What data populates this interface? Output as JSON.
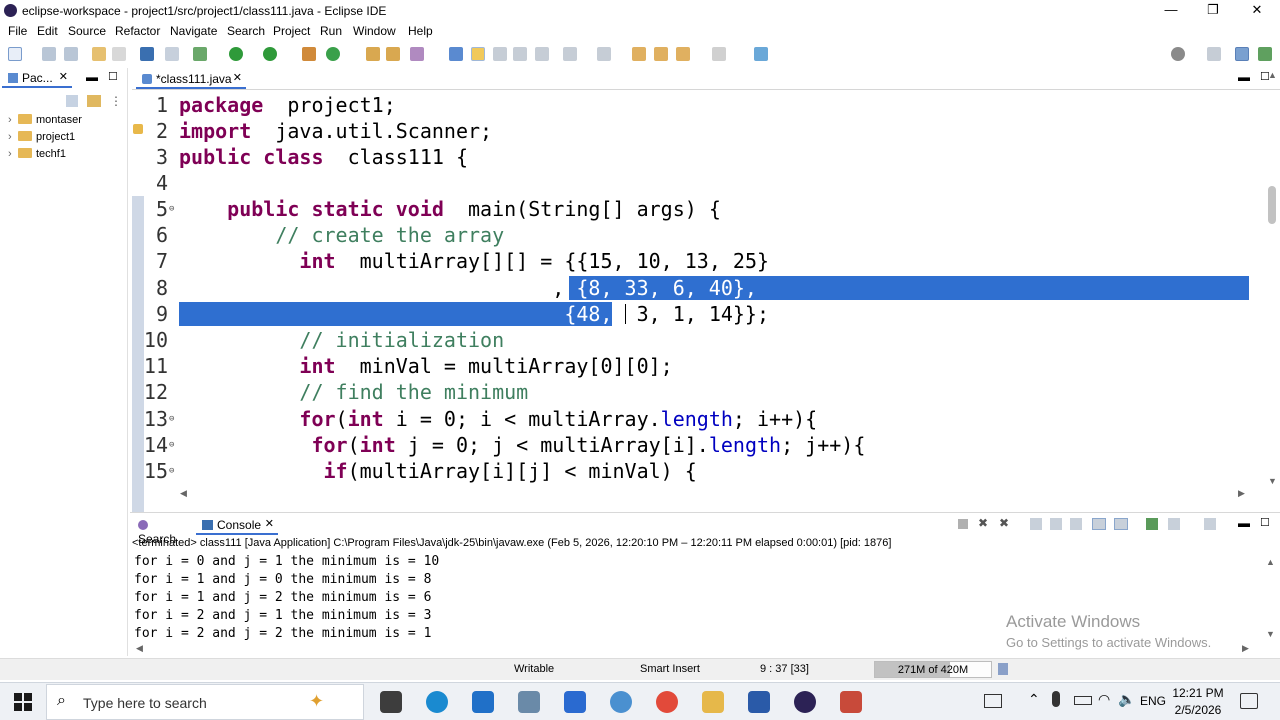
{
  "window": {
    "title": "eclipse-workspace - project1/src/project1/class111.java - Eclipse IDE",
    "controls": {
      "minimize": "—",
      "restore": "❐",
      "close": "✕"
    }
  },
  "menu": [
    "File",
    "Edit",
    "Source",
    "Refactor",
    "Navigate",
    "Search",
    "Project",
    "Run",
    "Window",
    "Help"
  ],
  "left_panel": {
    "tab_label": "Pac...",
    "tree": [
      {
        "label": "montaser"
      },
      {
        "label": "project1"
      },
      {
        "label": "techf1"
      }
    ]
  },
  "editor": {
    "tab_label": "*class111.java",
    "lines": [
      {
        "n": "1",
        "parts": [
          [
            "kw",
            "package"
          ],
          [
            "",
            "  project1;"
          ]
        ]
      },
      {
        "n": "2",
        "parts": [
          [
            "kw",
            "import"
          ],
          [
            "",
            "  java.util.Scanner;"
          ]
        ]
      },
      {
        "n": "3",
        "parts": [
          [
            "kw",
            "public"
          ],
          [
            "",
            " "
          ],
          [
            "kw",
            "class"
          ],
          [
            "",
            "  class111 {"
          ]
        ]
      },
      {
        "n": "4",
        "parts": []
      },
      {
        "n": "5",
        "fold": "⊖",
        "parts": [
          [
            "",
            "    "
          ],
          [
            "kw",
            "public"
          ],
          [
            "",
            " "
          ],
          [
            "kw",
            "static"
          ],
          [
            "",
            " "
          ],
          [
            "kw",
            "void"
          ],
          [
            "",
            "  main(String[] args) {"
          ]
        ]
      },
      {
        "n": "6",
        "parts": [
          [
            "",
            "        "
          ],
          [
            "cm",
            "// create the array"
          ]
        ]
      },
      {
        "n": "7",
        "parts": [
          [
            "",
            "          "
          ],
          [
            "kw",
            "int"
          ],
          [
            "",
            "  multiArray[][] = {{15, 10, 13, 25}"
          ]
        ]
      },
      {
        "n": "8",
        "parts": [
          [
            "",
            "                               , "
          ],
          [
            "sel",
            "{8, 33, 6, 40},"
          ]
        ]
      },
      {
        "n": "9",
        "parts": [
          [
            "sel",
            "                                {48,"
          ],
          [
            "",
            "  3, 1, 14}};"
          ]
        ]
      },
      {
        "n": "10",
        "parts": [
          [
            "",
            "          "
          ],
          [
            "cm",
            "// initialization"
          ]
        ]
      },
      {
        "n": "11",
        "parts": [
          [
            "",
            "          "
          ],
          [
            "kw",
            "int"
          ],
          [
            "",
            "  minVal = multiArray[0][0];"
          ]
        ]
      },
      {
        "n": "12",
        "parts": [
          [
            "",
            "          "
          ],
          [
            "cm",
            "// find the minimum"
          ]
        ]
      },
      {
        "n": "13",
        "fold": "⊖",
        "parts": [
          [
            "",
            "          "
          ],
          [
            "kw",
            "for"
          ],
          [
            "",
            "("
          ],
          [
            "kw",
            "int"
          ],
          [
            "",
            " i = 0; i < multiArray."
          ],
          [
            "fld",
            "length"
          ],
          [
            "",
            "; i++){"
          ]
        ]
      },
      {
        "n": "14",
        "fold": "⊖",
        "parts": [
          [
            "",
            "           "
          ],
          [
            "kw",
            "for"
          ],
          [
            "",
            "("
          ],
          [
            "kw",
            "int"
          ],
          [
            "",
            " j = 0; j < multiArray[i]."
          ],
          [
            "fld",
            "length"
          ],
          [
            "",
            "; j++){"
          ]
        ]
      },
      {
        "n": "15",
        "fold": "⊖",
        "parts": [
          [
            "",
            "            "
          ],
          [
            "kw",
            "if"
          ],
          [
            "",
            "(multiArray[i][j] < minVal) {"
          ]
        ]
      }
    ]
  },
  "console": {
    "tabs": [
      {
        "label": "Search"
      },
      {
        "label": "Console"
      }
    ],
    "header": "<terminated> class111 [Java Application] C:\\Program Files\\Java\\jdk-25\\bin\\javaw.exe  (Feb 5, 2026, 12:20:10 PM – 12:20:11 PM elapsed 0:00:01) [pid: 1876]",
    "lines": [
      "for i = 0 and j = 1 the minimum is = 10",
      "for i = 1 and j = 0 the minimum is = 8",
      "for i = 1 and j = 2 the minimum is = 6",
      "for i = 2 and j = 1 the minimum is = 3",
      "for i = 2 and j = 2 the minimum is = 1"
    ]
  },
  "watermark": {
    "title": "Activate Windows",
    "subtitle": "Go to Settings to activate Windows."
  },
  "status": {
    "writable": "Writable",
    "insert_mode": "Smart Insert",
    "position": "9 : 37 [33]",
    "heap": "271M of 420M",
    "heap_fraction": 0.645
  },
  "taskbar": {
    "search_placeholder": "Type here to search",
    "language": "ENG",
    "time": "12:21 PM",
    "date": "2/5/2026"
  },
  "colors": {
    "keyword": "#7f0055",
    "comment": "#3f7f5f",
    "field": "#0000c0",
    "selection": "#2f6fd0"
  }
}
